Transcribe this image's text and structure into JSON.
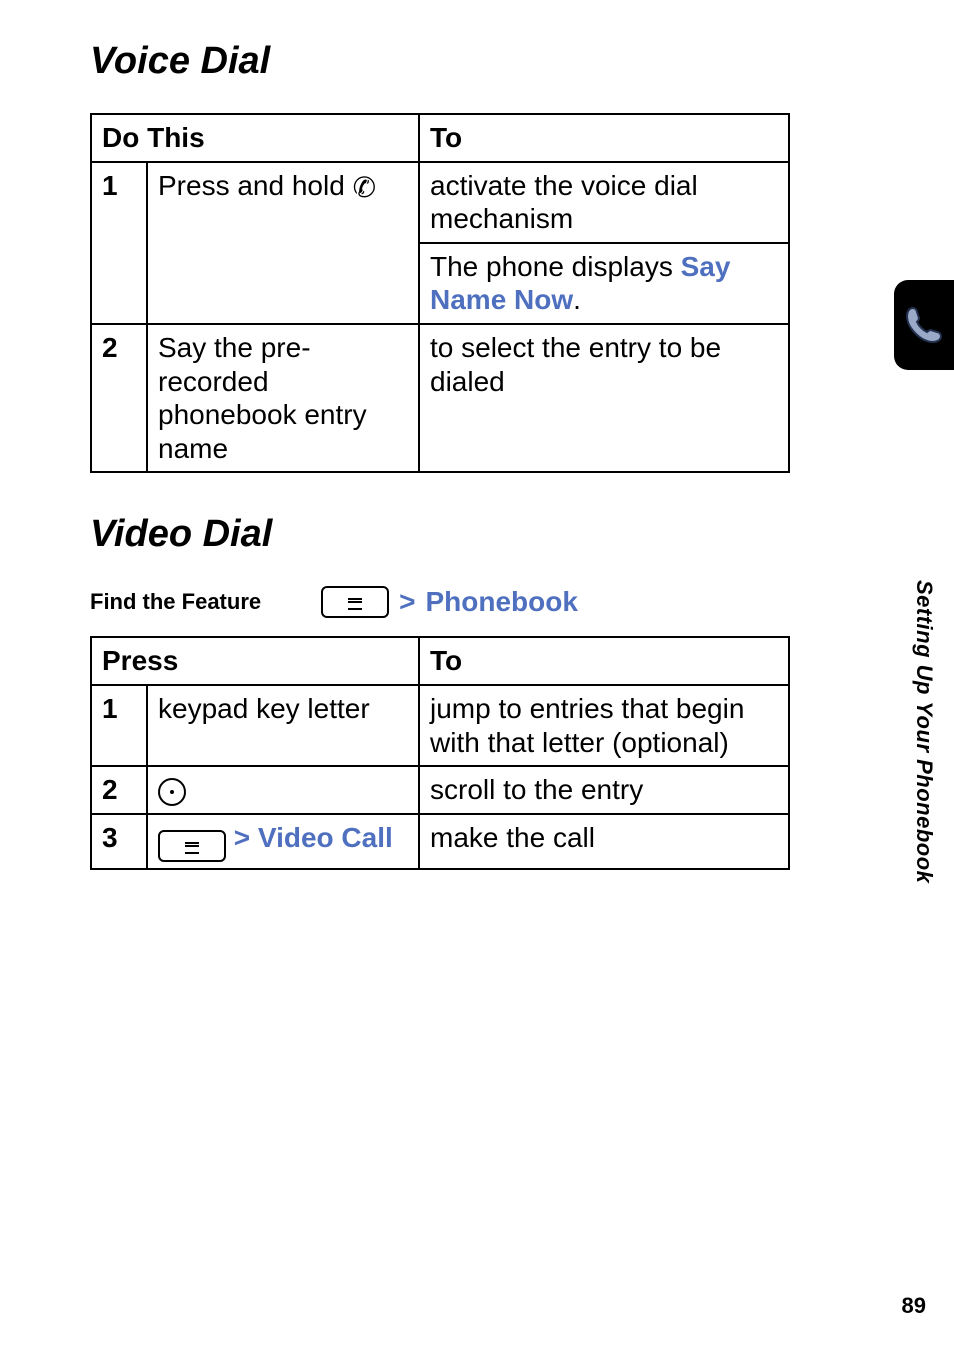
{
  "sections": {
    "voiceDial": {
      "title": "Voice Dial",
      "table": {
        "headers": {
          "left": "Do This",
          "right": "To"
        },
        "rows": [
          {
            "num": "1",
            "action_pre": "Press and hold",
            "action_icon": "handset",
            "result": "activate the voice dial mechanism"
          },
          {
            "continuation": true,
            "result_pre": "The phone displays ",
            "result_ui": "Say Name Now",
            "result_post": "."
          },
          {
            "num": "2",
            "action": "Say the pre-recorded phonebook entry name",
            "result": "to select the entry to be dialed"
          }
        ]
      }
    },
    "videoDial": {
      "title": "Video Dial",
      "find": {
        "label": "Find the Feature",
        "chevron": ">",
        "target": "Phonebook"
      },
      "table": {
        "headers": {
          "left": "Press",
          "right": "To"
        },
        "rows": [
          {
            "num": "1",
            "action": "keypad key letter",
            "result": "jump to entries that begin with that letter (optional)"
          },
          {
            "num": "2",
            "action_icon_only": "dpad",
            "result": "scroll to the entry"
          },
          {
            "num": "3",
            "menu_key": true,
            "chevron": ">",
            "ui_label": "Video Call",
            "result": "make the call"
          }
        ]
      }
    }
  },
  "side": {
    "vertical_label": "Setting Up Your Phonebook",
    "page_number": "89"
  }
}
